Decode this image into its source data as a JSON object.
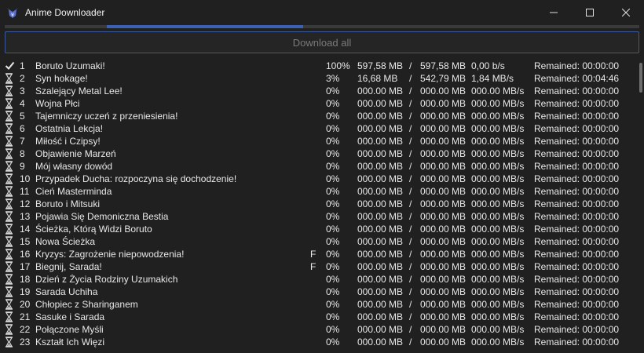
{
  "window": {
    "title": "Anime Downloader",
    "minimize_icon": "minimize-icon",
    "maximize_icon": "maximize-icon",
    "close_icon": "close-icon"
  },
  "overall_progress": 0.31,
  "download_all_label": "Download all",
  "colors": {
    "background": "#202020",
    "accent": "#3c61b4",
    "button_border": "#3c5a9a",
    "disabled_text": "#7a7a7a"
  },
  "episodes": [
    {
      "status": "done",
      "num": "1",
      "title": "Boruto Uzumaki!",
      "flag": "",
      "percent": "100%",
      "downloaded": "597,58 MB",
      "sep": "/",
      "total": "597,58 MB",
      "speed": "0,00 b/s",
      "remaining": "Remained: 00:00:00"
    },
    {
      "status": "pending",
      "num": "2",
      "title": "Syn hokage!",
      "flag": "",
      "percent": "3%",
      "downloaded": "16,68 MB",
      "sep": "/",
      "total": "542,79 MB",
      "speed": "1,84 MB/s",
      "remaining": "Remained: 00:04:46"
    },
    {
      "status": "pending",
      "num": "3",
      "title": "Szalejący Metal Lee!",
      "flag": "",
      "percent": "0%",
      "downloaded": "000.00 MB",
      "sep": "/",
      "total": "000.00 MB",
      "speed": "000.00 MB/s",
      "remaining": "Remained: 00:00:00"
    },
    {
      "status": "pending",
      "num": "4",
      "title": "Wojna Płci",
      "flag": "",
      "percent": "0%",
      "downloaded": "000.00 MB",
      "sep": "/",
      "total": "000.00 MB",
      "speed": "000.00 MB/s",
      "remaining": "Remained: 00:00:00"
    },
    {
      "status": "pending",
      "num": "5",
      "title": "Tajemniczy uczeń z przeniesienia!",
      "flag": "",
      "percent": "0%",
      "downloaded": "000.00 MB",
      "sep": "/",
      "total": "000.00 MB",
      "speed": "000.00 MB/s",
      "remaining": "Remained: 00:00:00"
    },
    {
      "status": "pending",
      "num": "6",
      "title": "Ostatnia Lekcja!",
      "flag": "",
      "percent": "0%",
      "downloaded": "000.00 MB",
      "sep": "/",
      "total": "000.00 MB",
      "speed": "000.00 MB/s",
      "remaining": "Remained: 00:00:00"
    },
    {
      "status": "pending",
      "num": "7",
      "title": "Miłość i Czipsy!",
      "flag": "",
      "percent": "0%",
      "downloaded": "000.00 MB",
      "sep": "/",
      "total": "000.00 MB",
      "speed": "000.00 MB/s",
      "remaining": "Remained: 00:00:00"
    },
    {
      "status": "pending",
      "num": "8",
      "title": "Objawienie Marzeń",
      "flag": "",
      "percent": "0%",
      "downloaded": "000.00 MB",
      "sep": "/",
      "total": "000.00 MB",
      "speed": "000.00 MB/s",
      "remaining": "Remained: 00:00:00"
    },
    {
      "status": "pending",
      "num": "9",
      "title": "Mój własny dowód",
      "flag": "",
      "percent": "0%",
      "downloaded": "000.00 MB",
      "sep": "/",
      "total": "000.00 MB",
      "speed": "000.00 MB/s",
      "remaining": "Remained: 00:00:00"
    },
    {
      "status": "pending",
      "num": "10",
      "title": "Przypadek Ducha: rozpoczyna się dochodzenie!",
      "flag": "",
      "percent": "0%",
      "downloaded": "000.00 MB",
      "sep": "/",
      "total": "000.00 MB",
      "speed": "000.00 MB/s",
      "remaining": "Remained: 00:00:00"
    },
    {
      "status": "pending",
      "num": "11",
      "title": "Cień Masterminda",
      "flag": "",
      "percent": "0%",
      "downloaded": "000.00 MB",
      "sep": "/",
      "total": "000.00 MB",
      "speed": "000.00 MB/s",
      "remaining": "Remained: 00:00:00"
    },
    {
      "status": "pending",
      "num": "12",
      "title": "Boruto i Mitsuki",
      "flag": "",
      "percent": "0%",
      "downloaded": "000.00 MB",
      "sep": "/",
      "total": "000.00 MB",
      "speed": "000.00 MB/s",
      "remaining": "Remained: 00:00:00"
    },
    {
      "status": "pending",
      "num": "13",
      "title": "Pojawia Się Demoniczna Bestia",
      "flag": "",
      "percent": "0%",
      "downloaded": "000.00 MB",
      "sep": "/",
      "total": "000.00 MB",
      "speed": "000.00 MB/s",
      "remaining": "Remained: 00:00:00"
    },
    {
      "status": "pending",
      "num": "14",
      "title": "Ścieżka, Którą Widzi Boruto",
      "flag": "",
      "percent": "0%",
      "downloaded": "000.00 MB",
      "sep": "/",
      "total": "000.00 MB",
      "speed": "000.00 MB/s",
      "remaining": "Remained: 00:00:00"
    },
    {
      "status": "pending",
      "num": "15",
      "title": "Nowa Ścieżka",
      "flag": "",
      "percent": "0%",
      "downloaded": "000.00 MB",
      "sep": "/",
      "total": "000.00 MB",
      "speed": "000.00 MB/s",
      "remaining": "Remained: 00:00:00"
    },
    {
      "status": "pending",
      "num": "16",
      "title": "Kryzys: Zagrożenie niepowodzenia!",
      "flag": "F",
      "percent": "0%",
      "downloaded": "000.00 MB",
      "sep": "/",
      "total": "000.00 MB",
      "speed": "000.00 MB/s",
      "remaining": "Remained: 00:00:00"
    },
    {
      "status": "pending",
      "num": "17",
      "title": "Biegnij, Sarada!",
      "flag": "F",
      "percent": "0%",
      "downloaded": "000.00 MB",
      "sep": "/",
      "total": "000.00 MB",
      "speed": "000.00 MB/s",
      "remaining": "Remained: 00:00:00"
    },
    {
      "status": "pending",
      "num": "18",
      "title": "Dzień z Życia Rodziny Uzumakich",
      "flag": "",
      "percent": "0%",
      "downloaded": "000.00 MB",
      "sep": "/",
      "total": "000.00 MB",
      "speed": "000.00 MB/s",
      "remaining": "Remained: 00:00:00"
    },
    {
      "status": "pending",
      "num": "19",
      "title": "Sarada Uchiha",
      "flag": "",
      "percent": "0%",
      "downloaded": "000.00 MB",
      "sep": "/",
      "total": "000.00 MB",
      "speed": "000.00 MB/s",
      "remaining": "Remained: 00:00:00"
    },
    {
      "status": "pending",
      "num": "20",
      "title": "Chłopiec z Sharinganem",
      "flag": "",
      "percent": "0%",
      "downloaded": "000.00 MB",
      "sep": "/",
      "total": "000.00 MB",
      "speed": "000.00 MB/s",
      "remaining": "Remained: 00:00:00"
    },
    {
      "status": "pending",
      "num": "21",
      "title": "Sasuke i Sarada",
      "flag": "",
      "percent": "0%",
      "downloaded": "000.00 MB",
      "sep": "/",
      "total": "000.00 MB",
      "speed": "000.00 MB/s",
      "remaining": "Remained: 00:00:00"
    },
    {
      "status": "pending",
      "num": "22",
      "title": "Połączone Myśli",
      "flag": "",
      "percent": "0%",
      "downloaded": "000.00 MB",
      "sep": "/",
      "total": "000.00 MB",
      "speed": "000.00 MB/s",
      "remaining": "Remained: 00:00:00"
    },
    {
      "status": "pending",
      "num": "23",
      "title": "Kształt Ich Więzi",
      "flag": "",
      "percent": "0%",
      "downloaded": "000.00 MB",
      "sep": "/",
      "total": "000.00 MB",
      "speed": "000.00 MB/s",
      "remaining": "Remained: 00:00:00"
    }
  ]
}
